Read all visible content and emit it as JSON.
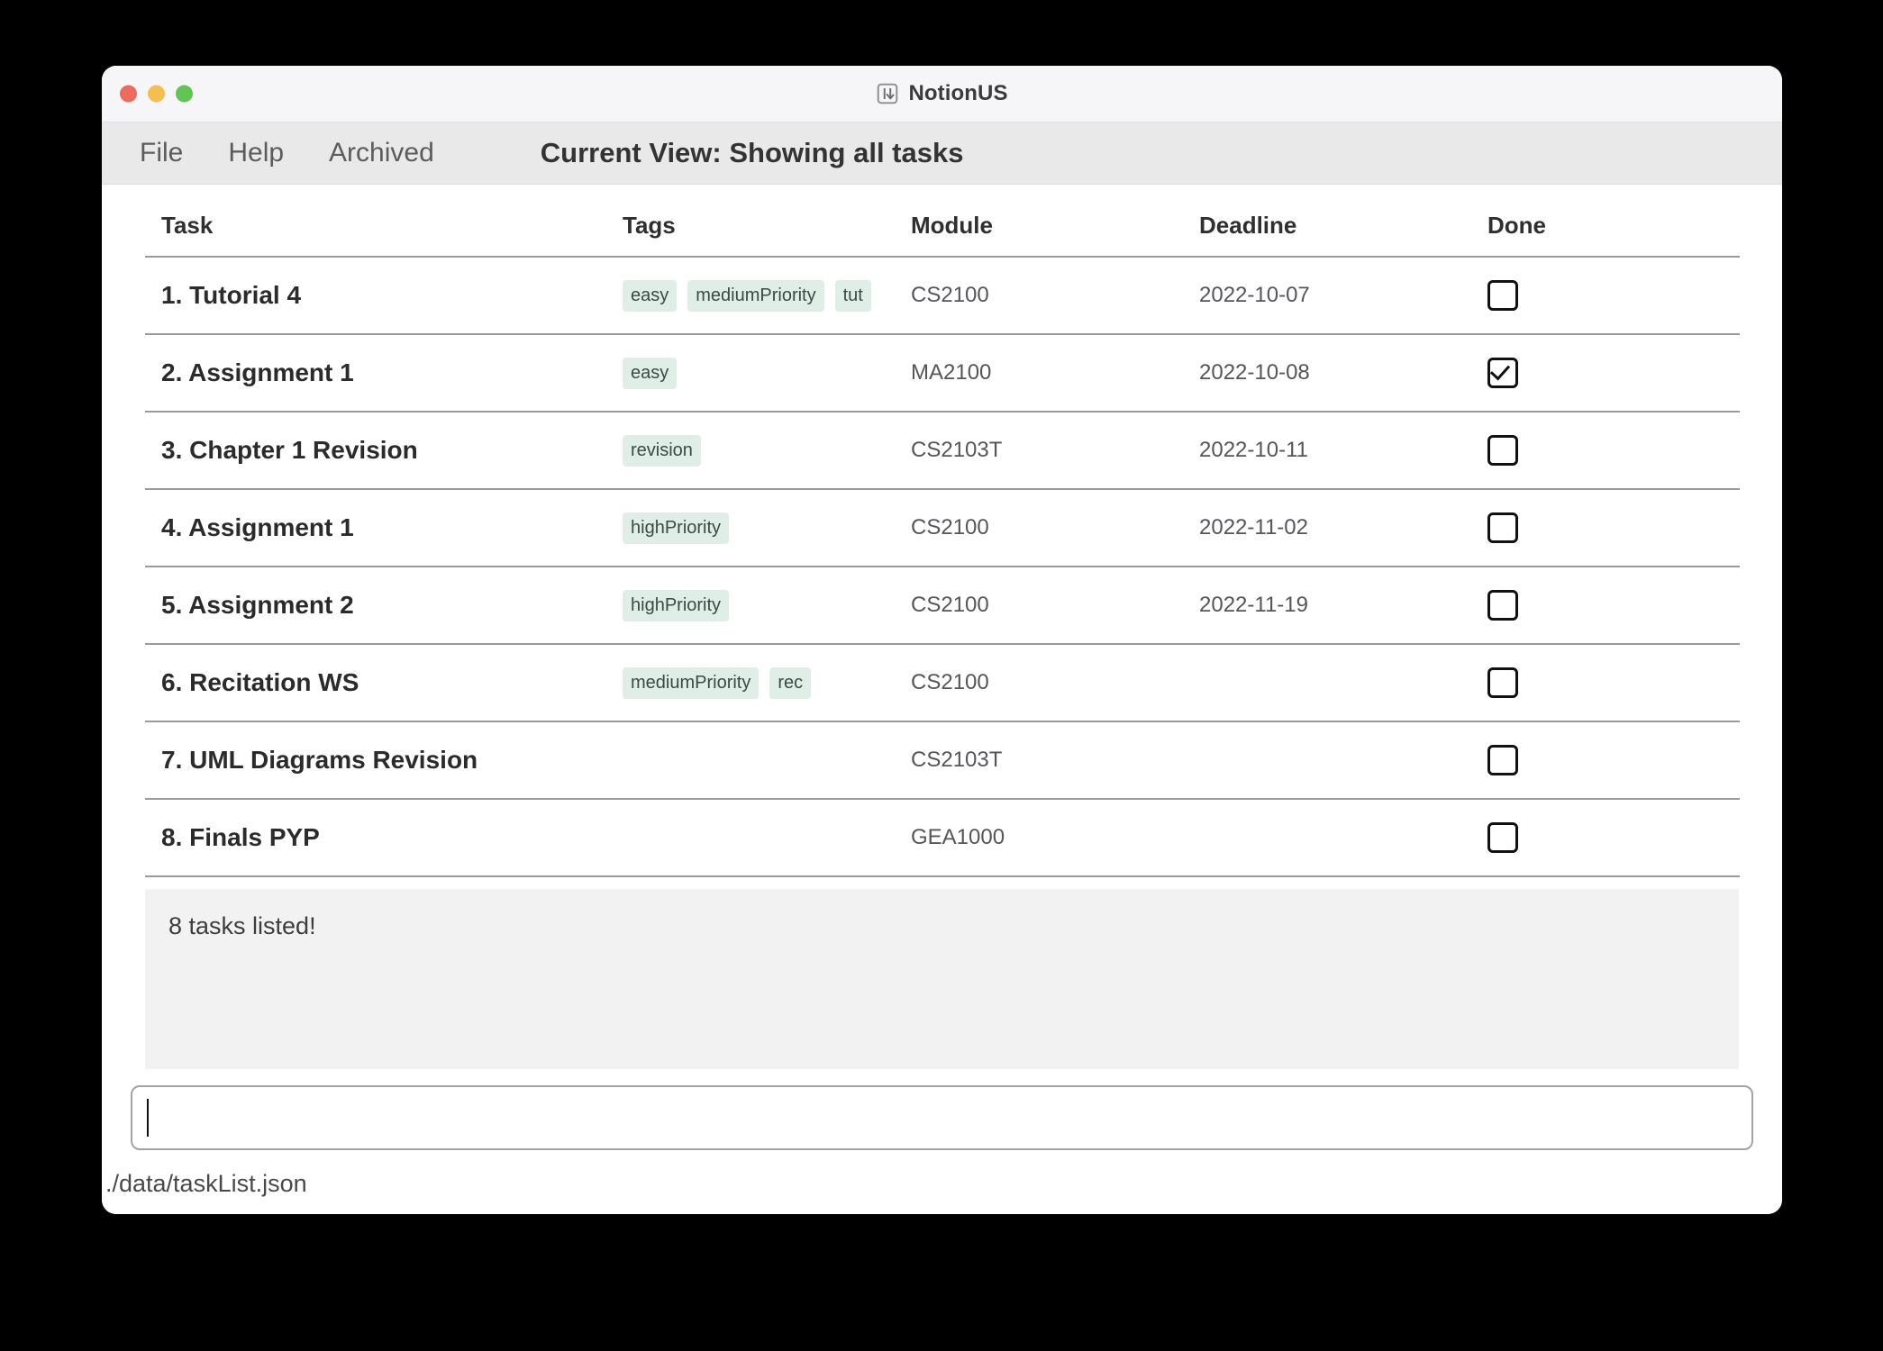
{
  "window": {
    "title": "NotionUS",
    "app_icon": "sort-descending-icon",
    "traffic_lights": [
      {
        "name": "close",
        "color": "#ed6a5e"
      },
      {
        "name": "minimize",
        "color": "#f5bf4f"
      },
      {
        "name": "maximize",
        "color": "#61c554"
      }
    ]
  },
  "menubar": {
    "items": [
      {
        "label": "File"
      },
      {
        "label": "Help"
      },
      {
        "label": "Archived"
      }
    ],
    "current_view": "Current View: Showing all tasks"
  },
  "table": {
    "columns": [
      "Task",
      "Tags",
      "Module",
      "Deadline",
      "Done"
    ],
    "rows": [
      {
        "task": "1. Tutorial 4",
        "tags": [
          "easy",
          "mediumPriority",
          "tut"
        ],
        "module": "CS2100",
        "deadline": "2022-10-07",
        "done": false
      },
      {
        "task": "2. Assignment 1",
        "tags": [
          "easy"
        ],
        "module": "MA2100",
        "deadline": "2022-10-08",
        "done": true
      },
      {
        "task": "3. Chapter 1 Revision",
        "tags": [
          "revision"
        ],
        "module": "CS2103T",
        "deadline": "2022-10-11",
        "done": false
      },
      {
        "task": "4. Assignment 1",
        "tags": [
          "highPriority"
        ],
        "module": "CS2100",
        "deadline": "2022-11-02",
        "done": false
      },
      {
        "task": "5. Assignment 2",
        "tags": [
          "highPriority"
        ],
        "module": "CS2100",
        "deadline": "2022-11-19",
        "done": false
      },
      {
        "task": "6. Recitation WS",
        "tags": [
          "mediumPriority",
          "rec"
        ],
        "module": "CS2100",
        "deadline": "",
        "done": false
      },
      {
        "task": "7. UML Diagrams Revision",
        "tags": [],
        "module": "CS2103T",
        "deadline": "",
        "done": false
      },
      {
        "task": "8. Finals PYP",
        "tags": [],
        "module": "GEA1000",
        "deadline": "",
        "done": false
      }
    ]
  },
  "message_panel": {
    "text": "8 tasks listed!"
  },
  "command_input": {
    "value": "",
    "placeholder": ""
  },
  "statusbar": {
    "path": "./data/taskList.json"
  },
  "colors": {
    "tag_background": "#dfeee7",
    "tag_text": "#3a4a44",
    "menubar_background": "#e9e9e9",
    "titlebar_background": "#f6f5f7",
    "message_panel_background": "#f2f2f2",
    "row_divider": "#9a9a9a"
  }
}
